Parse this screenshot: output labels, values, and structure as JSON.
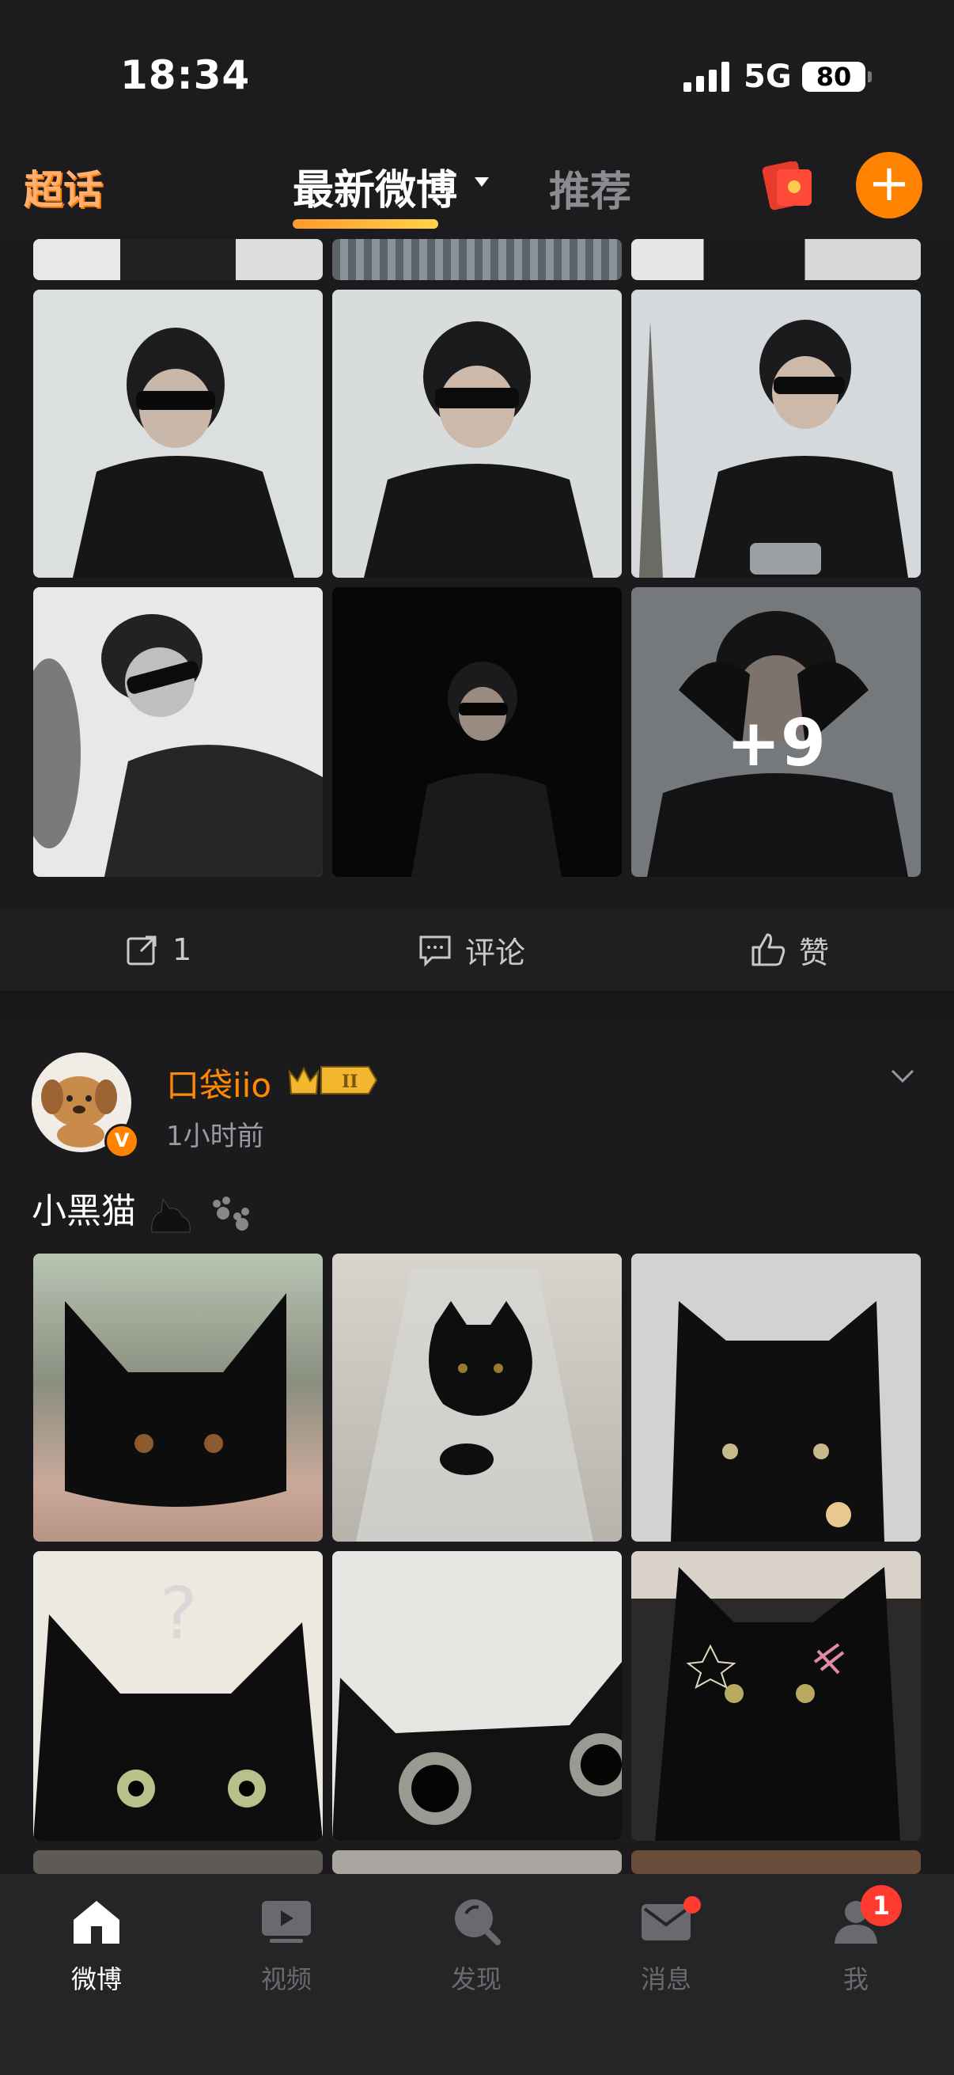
{
  "status": {
    "time": "18:34",
    "network": "5G",
    "battery": "80"
  },
  "nav": {
    "chaohua": "超话",
    "latest_tab": "最新微博",
    "recommend_tab": "推荐"
  },
  "post1": {
    "more_count": "+9",
    "repost_count": "1",
    "comment_label": "评论",
    "like_label": "赞"
  },
  "post2": {
    "author": "口袋iio",
    "time": "1小时前",
    "text": "小黑猫"
  },
  "tabbar": {
    "items": [
      "微博",
      "视频",
      "发现",
      "消息",
      "我"
    ],
    "me_badge": "1"
  },
  "colors": {
    "accent": "#ff8200",
    "background": "#1b1b1d",
    "badge": "#ff3b30"
  }
}
